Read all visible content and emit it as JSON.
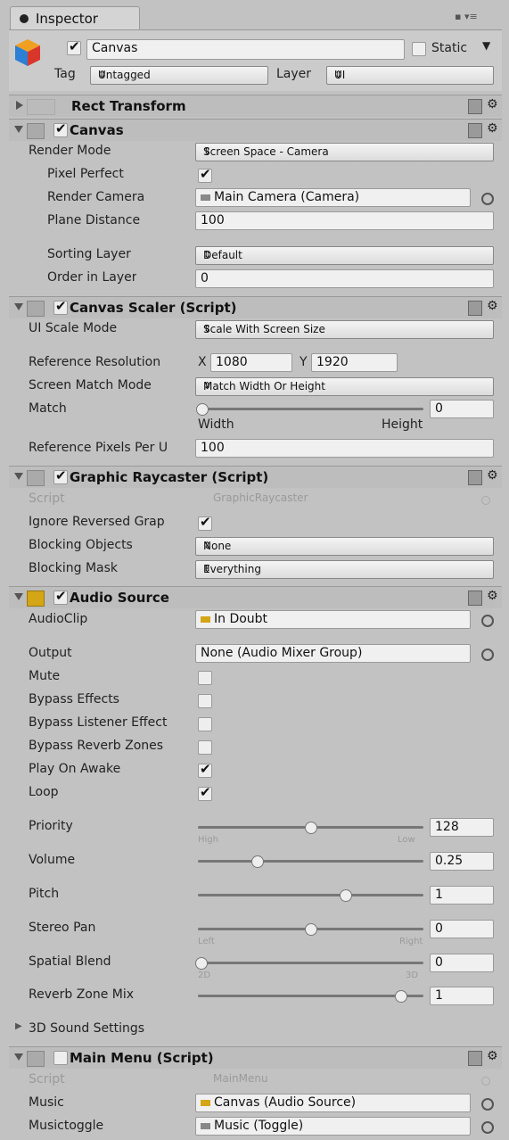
{
  "tab": {
    "title": "Inspector"
  },
  "object": {
    "name": "Canvas",
    "static_label": "Static",
    "tag_label": "Tag",
    "tag_value": "Untagged",
    "layer_label": "Layer",
    "layer_value": "UI"
  },
  "rect_transform": {
    "title": "Rect Transform"
  },
  "canvas": {
    "title": "Canvas",
    "render_mode_label": "Render Mode",
    "render_mode_value": "Screen Space - Camera",
    "pixel_perfect_label": "Pixel Perfect",
    "render_camera_label": "Render Camera",
    "render_camera_value": "Main Camera (Camera)",
    "plane_distance_label": "Plane Distance",
    "plane_distance_value": "100",
    "sorting_layer_label": "Sorting Layer",
    "sorting_layer_value": "Default",
    "order_label": "Order in Layer",
    "order_value": "0"
  },
  "scaler": {
    "title": "Canvas Scaler (Script)",
    "ui_scale_label": "UI Scale Mode",
    "ui_scale_value": "Scale With Screen Size",
    "ref_res_label": "Reference Resolution",
    "x_label": "X",
    "x_value": "1080",
    "y_label": "Y",
    "y_value": "1920",
    "match_mode_label": "Screen Match Mode",
    "match_mode_value": "Match Width Or Height",
    "match_label": "Match",
    "match_value": "0",
    "width_label": "Width",
    "height_label": "Height",
    "ref_ppu_label": "Reference Pixels Per U",
    "ref_ppu_value": "100"
  },
  "raycaster": {
    "title": "Graphic Raycaster (Script)",
    "script_label": "Script",
    "script_value": "GraphicRaycaster",
    "ignore_label": "Ignore Reversed Grap",
    "blocking_objects_label": "Blocking Objects",
    "blocking_objects_value": "None",
    "blocking_mask_label": "Blocking Mask",
    "blocking_mask_value": "Everything"
  },
  "audio": {
    "title": "Audio Source",
    "clip_label": "AudioClip",
    "clip_value": "In Doubt",
    "output_label": "Output",
    "output_value": "None (Audio Mixer Group)",
    "mute_label": "Mute",
    "bypass_effects_label": "Bypass Effects",
    "bypass_listener_label": "Bypass Listener Effect",
    "bypass_reverb_label": "Bypass Reverb Zones",
    "play_on_awake_label": "Play On Awake",
    "loop_label": "Loop",
    "priority_label": "Priority",
    "priority_value": "128",
    "priority_low": "High",
    "priority_high": "Low",
    "volume_label": "Volume",
    "volume_value": "0.25",
    "pitch_label": "Pitch",
    "pitch_value": "1",
    "stereo_label": "Stereo Pan",
    "stereo_value": "0",
    "stereo_left": "Left",
    "stereo_right": "Right",
    "spatial_label": "Spatial Blend",
    "spatial_value": "0",
    "spatial_2d": "2D",
    "spatial_3d": "3D",
    "reverb_mix_label": "Reverb Zone Mix",
    "reverb_mix_value": "1",
    "sound3d_label": "3D Sound Settings"
  },
  "mainmenu": {
    "title": "Main Menu (Script)",
    "script_label": "Script",
    "script_value": "MainMenu",
    "music_label": "Music",
    "music_value": "Canvas (Audio Source)",
    "musictoggle_label": "Musictoggle",
    "musictoggle_value": "Music (Toggle)"
  },
  "colors": {
    "audio_icon": "#d4a514",
    "background": "#c2c2c2"
  }
}
